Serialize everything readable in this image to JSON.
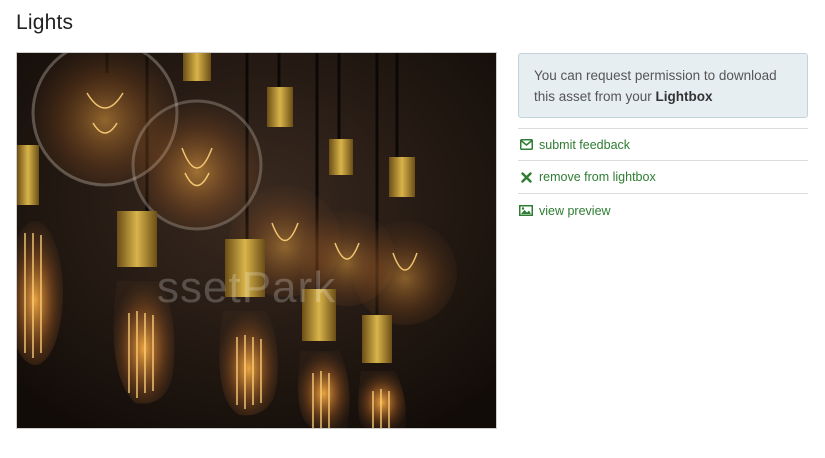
{
  "page": {
    "title": "Lights"
  },
  "asset": {
    "image_icon": "edison-bulbs-photo",
    "watermark": "ssetPark"
  },
  "info": {
    "text": "You can request permission to download this asset from your ",
    "link": "Lightbox"
  },
  "actions": [
    {
      "label": "submit feedback",
      "icon": "envelope-icon"
    },
    {
      "label": "remove from lightbox",
      "icon": "times-icon"
    },
    {
      "label": "view preview",
      "icon": "image-icon"
    }
  ],
  "colors": {
    "accent": "#2e7d32",
    "info_bg": "#e6eef2"
  }
}
